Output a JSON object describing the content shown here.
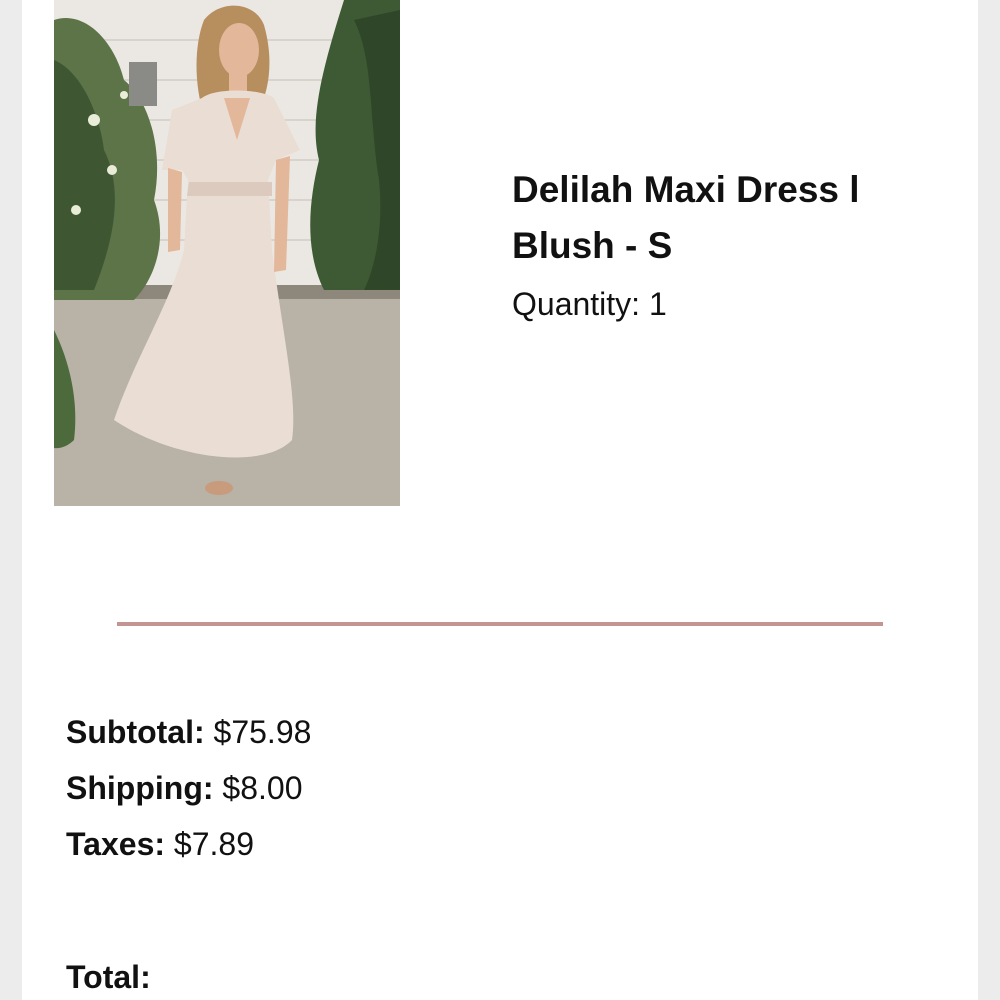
{
  "product": {
    "image_alt": "Woman wearing blush maxi dress",
    "name": "Delilah Maxi Dress l Blush - S",
    "quantity_label": "Quantity:",
    "quantity_value": "1"
  },
  "summary": {
    "subtotal_label": "Subtotal:",
    "subtotal_value": "$75.98",
    "shipping_label": "Shipping:",
    "shipping_value": "$8.00",
    "taxes_label": "Taxes:",
    "taxes_value": "$7.89",
    "total_label": "Total:"
  },
  "colors": {
    "divider": "#c29593",
    "page_background": "#ececec",
    "card_background": "#ffffff"
  }
}
